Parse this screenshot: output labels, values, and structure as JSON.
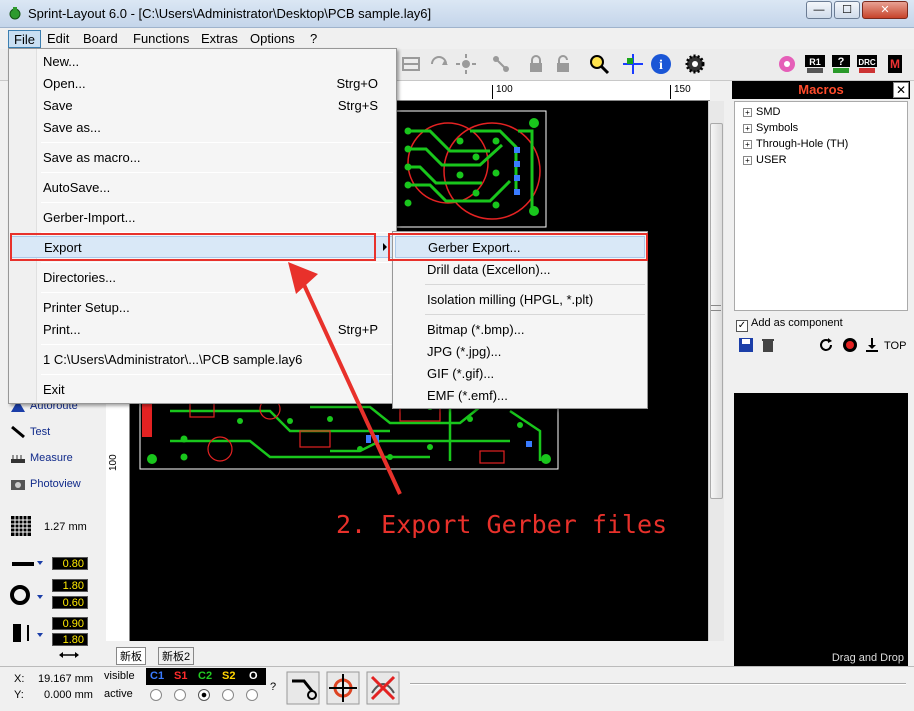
{
  "window": {
    "title": "Sprint-Layout 6.0 - [C:\\Users\\Administrator\\Desktop\\PCB sample.lay6]",
    "minimize": "—",
    "maximize": "☐",
    "close": "✕"
  },
  "menubar": {
    "items": [
      "File",
      "Edit",
      "Board",
      "Functions",
      "Extras",
      "Options",
      "?"
    ]
  },
  "file_menu": {
    "items": [
      {
        "label": "New...",
        "shortcut": ""
      },
      {
        "label": "Open...",
        "shortcut": "Strg+O"
      },
      {
        "label": "Save",
        "shortcut": "Strg+S"
      },
      {
        "label": "Save as...",
        "shortcut": ""
      },
      {
        "label": "Save as macro...",
        "shortcut": ""
      },
      {
        "label": "AutoSave...",
        "shortcut": ""
      },
      {
        "label": "Gerber-Import...",
        "shortcut": ""
      },
      {
        "label": "Export",
        "shortcut": ""
      },
      {
        "label": "Directories...",
        "shortcut": ""
      },
      {
        "label": "Printer Setup...",
        "shortcut": ""
      },
      {
        "label": "Print...",
        "shortcut": "Strg+P"
      },
      {
        "label": "1 C:\\Users\\Administrator\\...\\PCB sample.lay6",
        "shortcut": ""
      },
      {
        "label": "Exit",
        "shortcut": ""
      }
    ]
  },
  "export_submenu": {
    "items": [
      "Gerber Export...",
      "Drill data (Excellon)...",
      "Isolation milling (HPGL, *.plt)",
      "Bitmap (*.bmp)...",
      "JPG (*.jpg)...",
      "GIF (*.gif)...",
      "EMF (*.emf)..."
    ]
  },
  "annotation": "2. Export Gerber files",
  "ruler": {
    "top_100": "100",
    "top_150": "150",
    "left_100": "100"
  },
  "tools": {
    "autoroute": "Autoroute",
    "test": "Test",
    "measure": "Measure",
    "photoview": "Photoview",
    "grid": "1.27 mm"
  },
  "widths": {
    "track": "0.80",
    "pad_outer": "1.80",
    "pad_inner": "0.60",
    "smd_w": "0.90",
    "smd_h": "1.80"
  },
  "macros": {
    "title": "Macros",
    "close": "✕",
    "tree": [
      "SMD",
      "Symbols",
      "Through-Hole (TH)",
      "USER"
    ],
    "add_component": "Add as component",
    "top": "TOP",
    "drag_drop": "Drag and Drop"
  },
  "tabs": [
    "新板",
    "新板2"
  ],
  "status": {
    "x_label": "X:",
    "x_value": "19.167 mm",
    "y_label": "Y:",
    "y_value": "0.000 mm",
    "visible": "visible",
    "active": "active",
    "layers": [
      {
        "name": "C1",
        "color": "#3a7bff"
      },
      {
        "name": "S1",
        "color": "#ff2b2b"
      },
      {
        "name": "C2",
        "color": "#22cc22"
      },
      {
        "name": "S2",
        "color": "#ffd400"
      },
      {
        "name": "O",
        "color": "#ffffff"
      }
    ],
    "help": "?"
  },
  "colors": {
    "highlight_red": "#e8312b",
    "copper_green": "#19c61c",
    "silk_red": "#e32222"
  }
}
